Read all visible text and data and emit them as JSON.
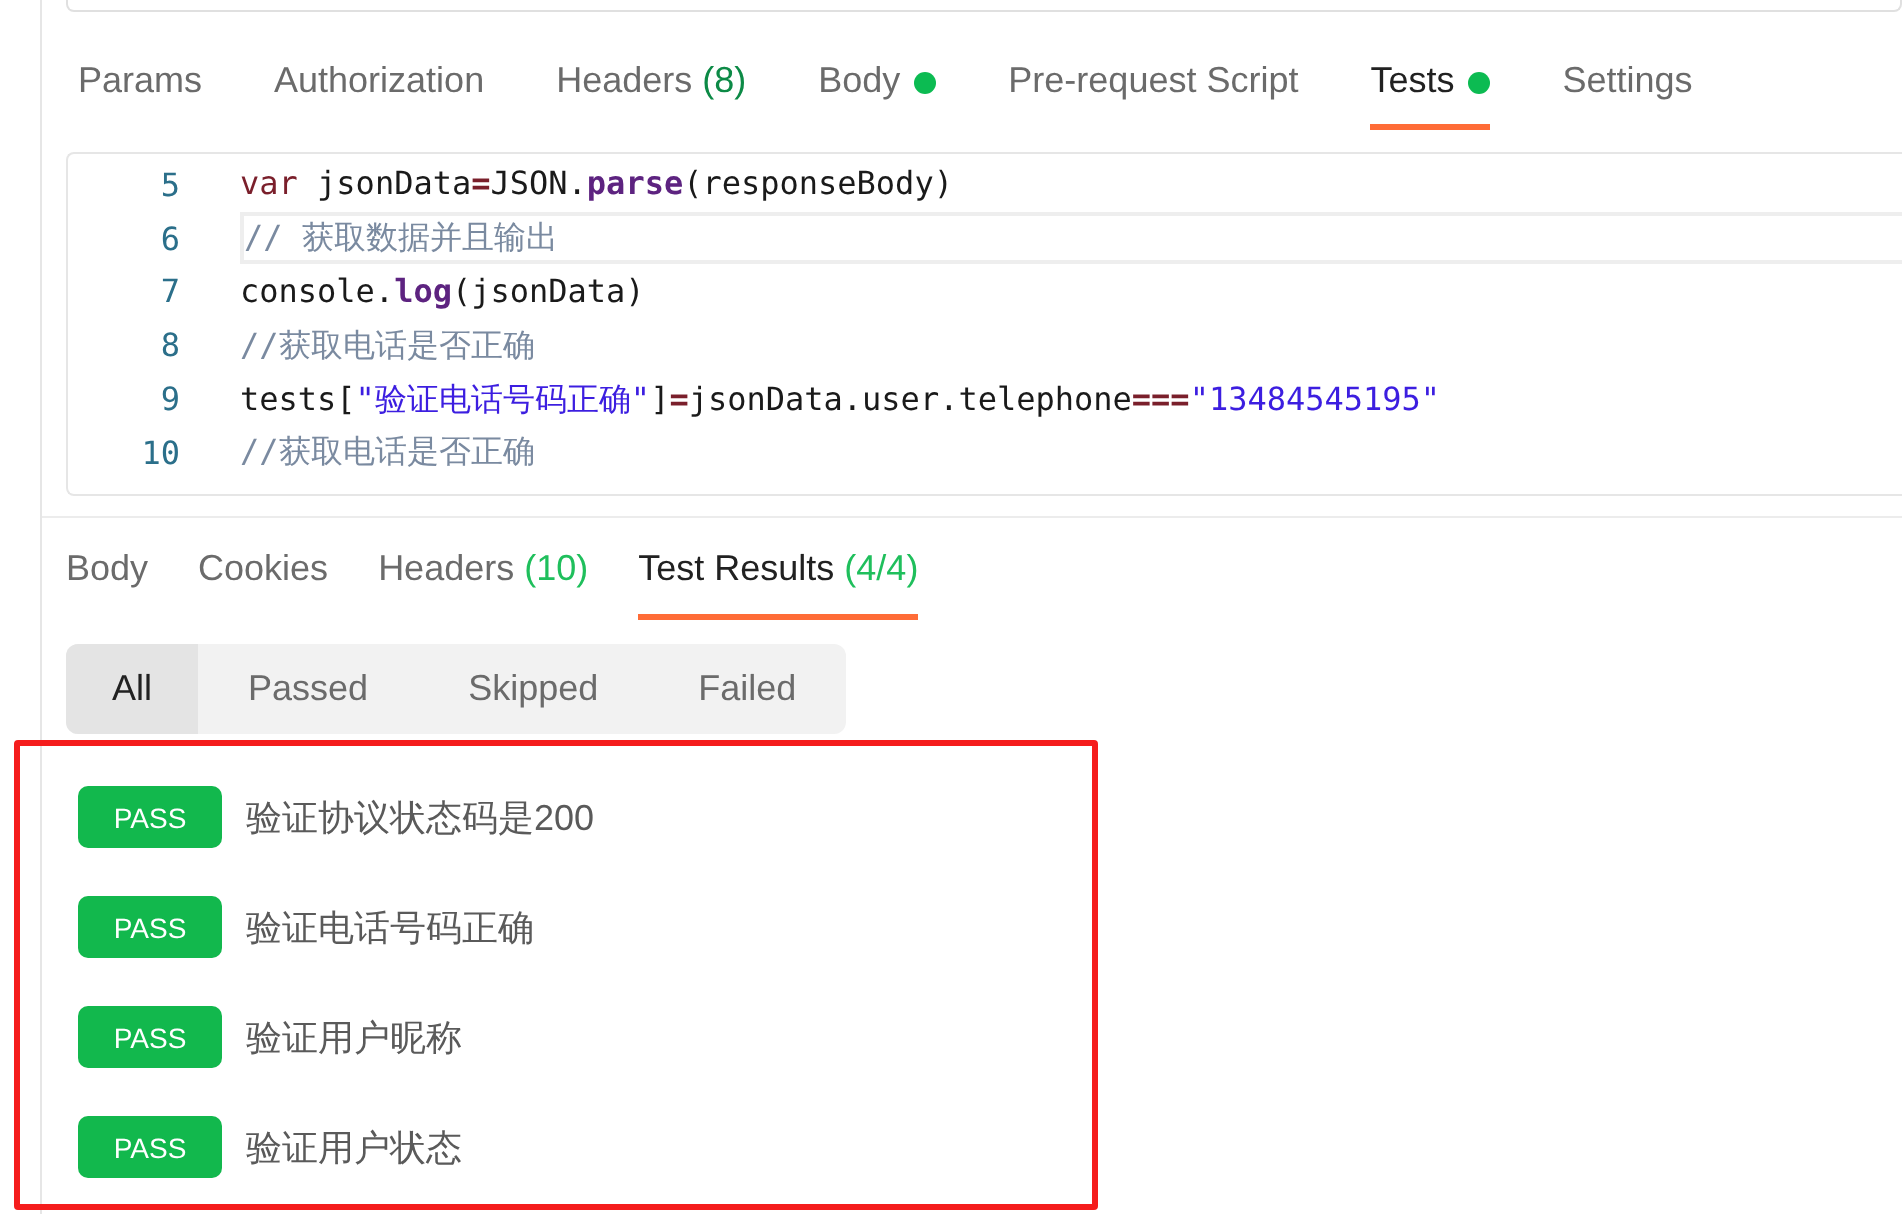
{
  "request_tabs": [
    {
      "label": "Params",
      "selected": false
    },
    {
      "label": "Authorization",
      "selected": false
    },
    {
      "label": "Headers",
      "count": "(8)",
      "selected": false
    },
    {
      "label": "Body",
      "dot": true,
      "selected": false
    },
    {
      "label": "Pre-request Script",
      "selected": false
    },
    {
      "label": "Tests",
      "dot": true,
      "selected": true
    },
    {
      "label": "Settings",
      "selected": false
    }
  ],
  "editor": {
    "lines": [
      {
        "number": "5",
        "active": false,
        "tokens": [
          {
            "kind": "keyword",
            "text": "var"
          },
          {
            "kind": "plain",
            "text": " jsonData"
          },
          {
            "kind": "op",
            "text": "="
          },
          {
            "kind": "plain",
            "text": "JSON."
          },
          {
            "kind": "method",
            "text": "parse"
          },
          {
            "kind": "plain",
            "text": "(responseBody)"
          }
        ]
      },
      {
        "number": "6",
        "active": true,
        "tokens": [
          {
            "kind": "comment",
            "text": "// 获取数据并且输出"
          }
        ]
      },
      {
        "number": "7",
        "active": false,
        "tokens": [
          {
            "kind": "plain",
            "text": "console."
          },
          {
            "kind": "method",
            "text": "log"
          },
          {
            "kind": "plain",
            "text": "(jsonData)"
          }
        ]
      },
      {
        "number": "8",
        "active": false,
        "tokens": [
          {
            "kind": "comment",
            "text": "//获取电话是否正确"
          }
        ]
      },
      {
        "number": "9",
        "active": false,
        "tokens": [
          {
            "kind": "plain",
            "text": "tests["
          },
          {
            "kind": "string",
            "text": "\"验证电话号码正确\""
          },
          {
            "kind": "plain",
            "text": "]"
          },
          {
            "kind": "op",
            "text": "="
          },
          {
            "kind": "plain",
            "text": "jsonData.user.telephone"
          },
          {
            "kind": "op",
            "text": "==="
          },
          {
            "kind": "string",
            "text": "\"13484545195\""
          }
        ]
      },
      {
        "number": "10",
        "active": false,
        "tokens": [
          {
            "kind": "comment",
            "text": "//获取电话是否正确"
          }
        ]
      }
    ]
  },
  "response_tabs": [
    {
      "label": "Body",
      "selected": false
    },
    {
      "label": "Cookies",
      "selected": false
    },
    {
      "label": "Headers",
      "count": "(10)",
      "selected": false
    },
    {
      "label": "Test Results",
      "count": "(4/4)",
      "selected": true
    }
  ],
  "filters": [
    {
      "label": "All",
      "selected": true
    },
    {
      "label": "Passed",
      "selected": false
    },
    {
      "label": "Skipped",
      "selected": false
    },
    {
      "label": "Failed",
      "selected": false
    }
  ],
  "results": [
    {
      "status": "PASS",
      "name": "验证协议状态码是200"
    },
    {
      "status": "PASS",
      "name": "验证电话号码正确"
    },
    {
      "status": "PASS",
      "name": "验证用户昵称"
    },
    {
      "status": "PASS",
      "name": "验证用户状态"
    }
  ]
}
